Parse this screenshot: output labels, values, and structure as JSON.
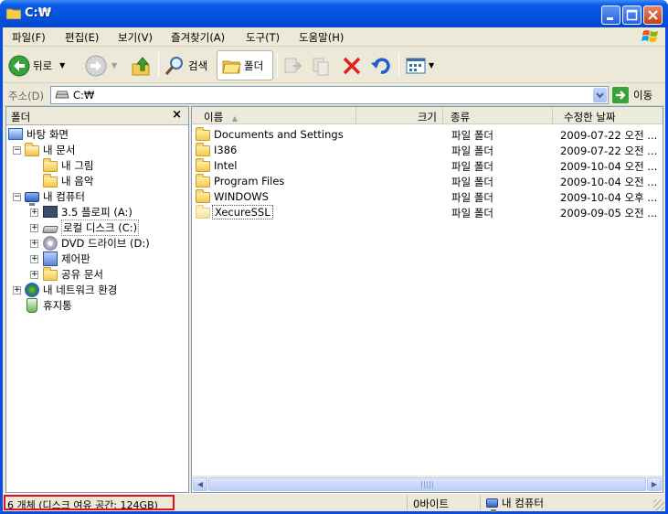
{
  "window": {
    "title": "C:₩"
  },
  "menu": [
    "파일(F)",
    "편집(E)",
    "보기(V)",
    "즐겨찾기(A)",
    "도구(T)",
    "도움말(H)"
  ],
  "toolbar": {
    "back_label": "뒤로",
    "search_label": "검색",
    "folders_label": "폴더"
  },
  "address": {
    "label": "주소(D)",
    "value": "C:₩",
    "go_label": "이동"
  },
  "folders_pane": {
    "title": "폴더",
    "close": "×",
    "tree": {
      "desktop": "바탕 화면",
      "my_documents": "내 문서",
      "my_pictures": "내 그림",
      "my_music": "내 음악",
      "my_computer": "내 컴퓨터",
      "floppy": "3.5 플로피 (A:)",
      "local_disk": "로컬 디스크 (C:)",
      "dvd": "DVD 드라이브 (D:)",
      "control_panel": "제어판",
      "shared_docs": "공유 문서",
      "network": "내 네트워크 환경",
      "recycle_bin": "휴지통"
    }
  },
  "file_list": {
    "columns": {
      "name": "이름",
      "size": "크기",
      "type": "종류",
      "modified": "수정한 날짜"
    },
    "rows": [
      {
        "name": "Documents and Settings",
        "type": "파일 폴더",
        "modified": "2009-07-22 오전 ..."
      },
      {
        "name": "I386",
        "type": "파일 폴더",
        "modified": "2009-07-22 오전 ..."
      },
      {
        "name": "Intel",
        "type": "파일 폴더",
        "modified": "2009-10-04 오전 ..."
      },
      {
        "name": "Program Files",
        "type": "파일 폴더",
        "modified": "2009-10-04 오전 ..."
      },
      {
        "name": "WINDOWS",
        "type": "파일 폴더",
        "modified": "2009-10-04 오후 ..."
      },
      {
        "name": "XecureSSL",
        "type": "파일 폴더",
        "modified": "2009-09-05 오전 ..."
      }
    ]
  },
  "status": {
    "count": "6 개체 (디스크 여유 공간: 124GB)",
    "size": "0바이트",
    "location": "내 컴퓨터"
  },
  "colors": {
    "title_blue": "#0553e0",
    "highlight_red": "#e0101c",
    "face": "#ece9d8"
  }
}
